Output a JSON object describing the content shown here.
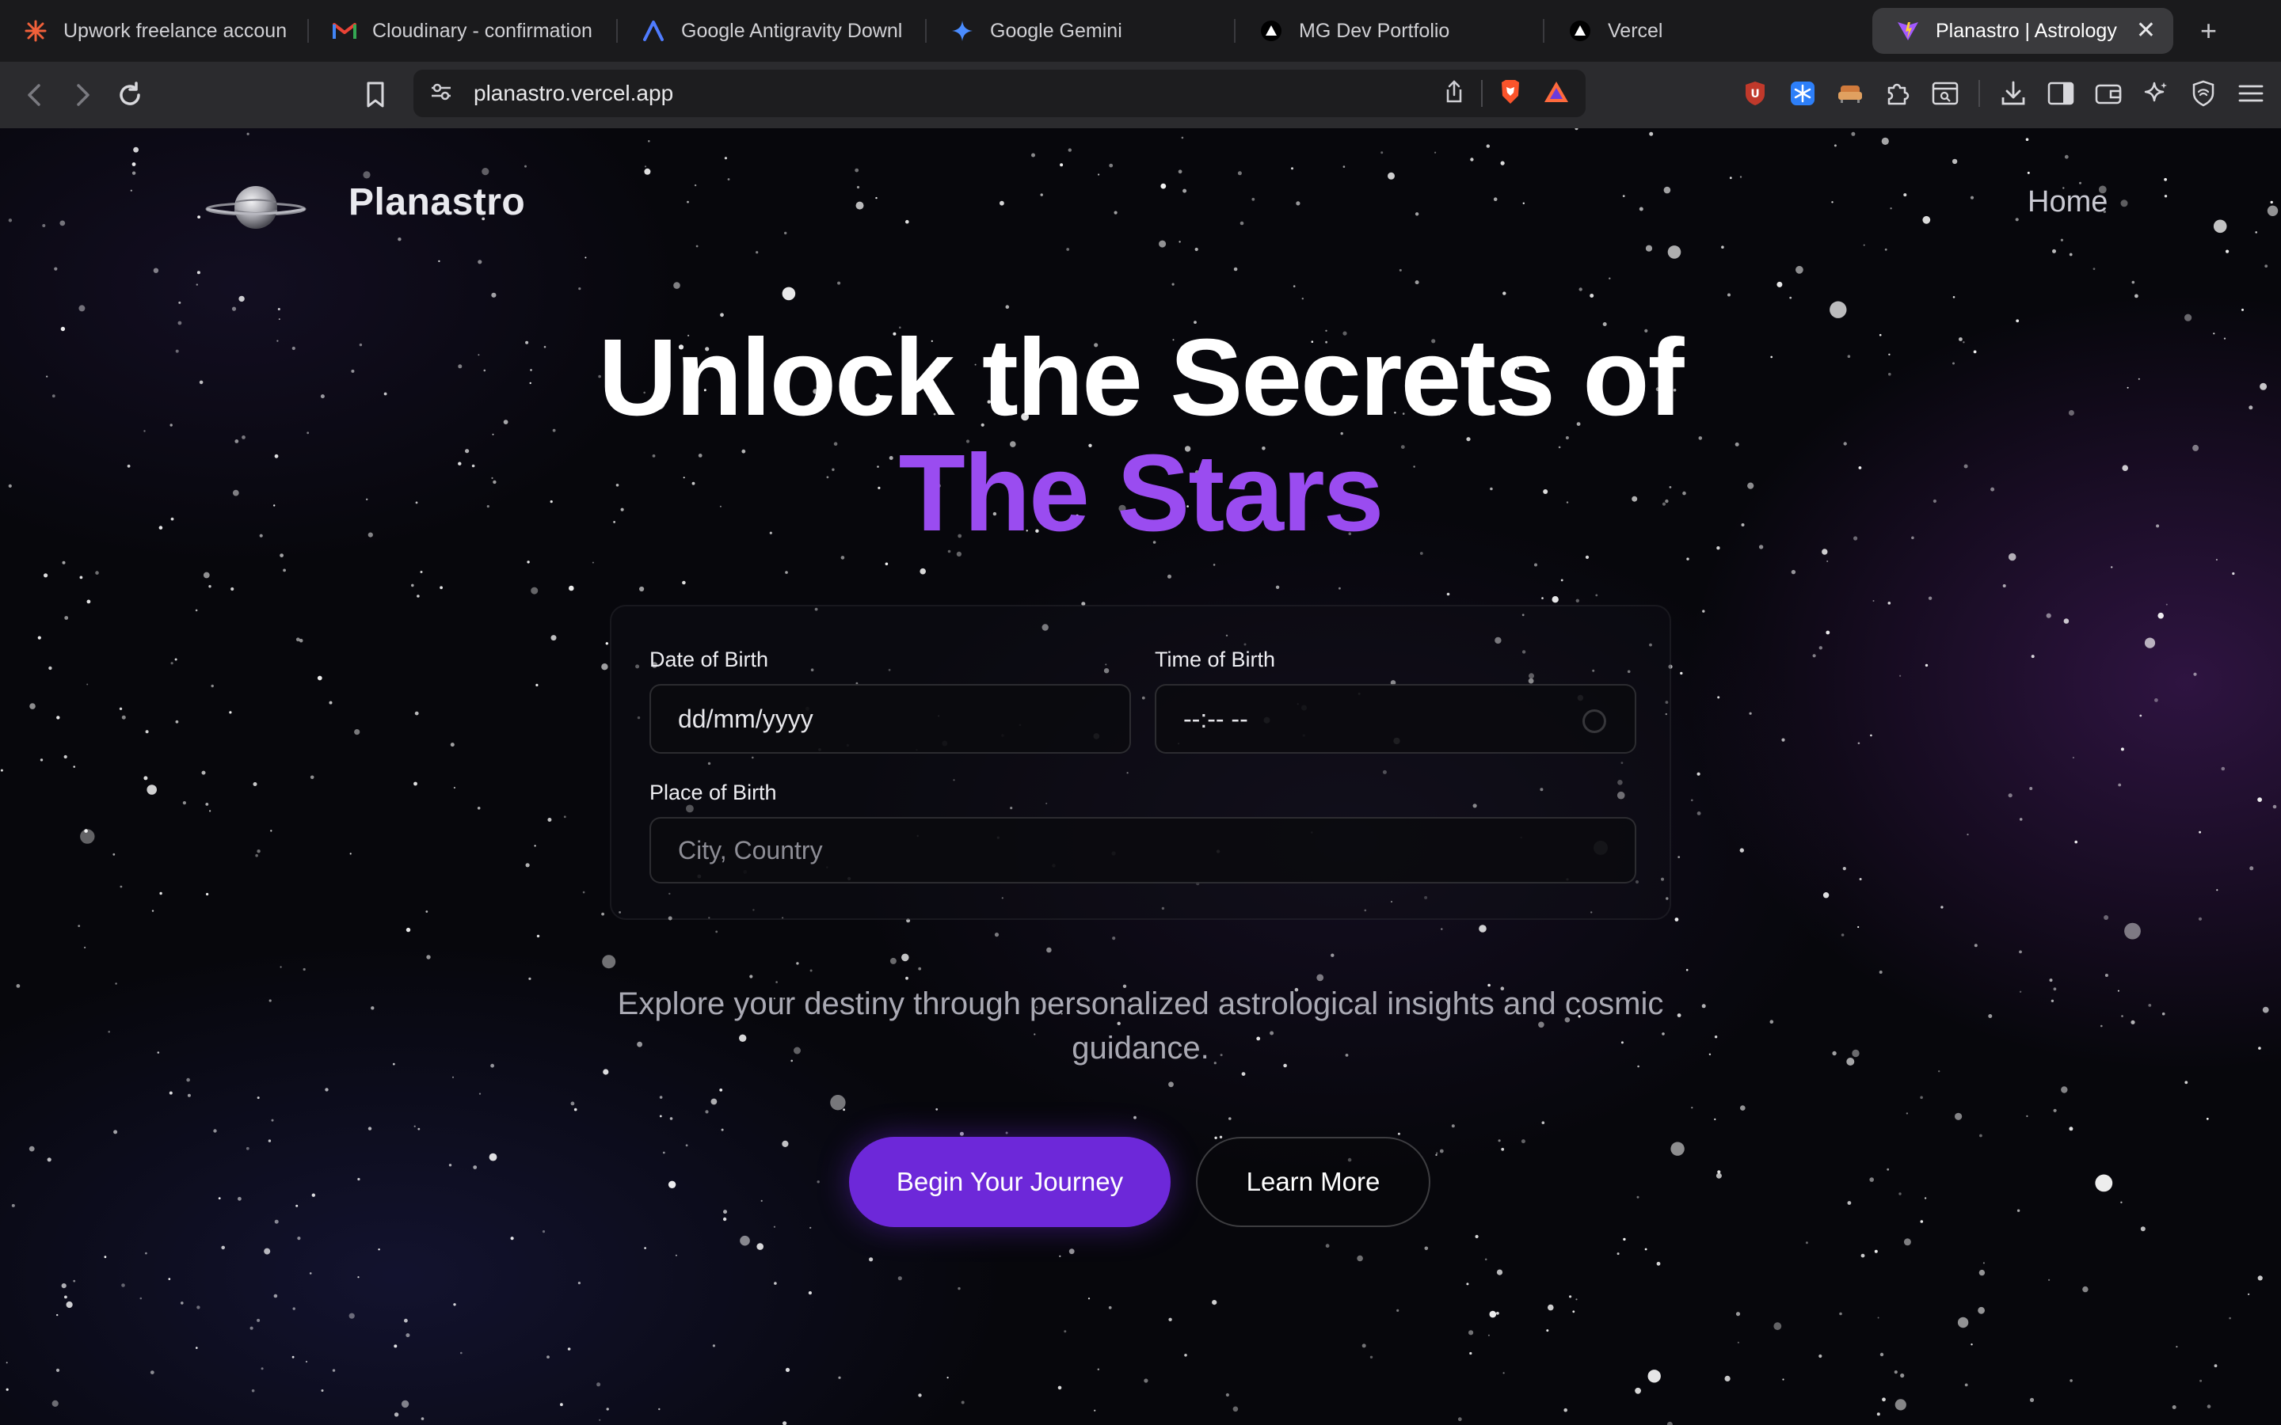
{
  "browser": {
    "tabs": [
      {
        "label": "Upwork freelance accoun",
        "icon": "upwork-asterisk-icon",
        "color": "#f0603a",
        "active": false
      },
      {
        "label": "Cloudinary - confirmation",
        "icon": "gmail-icon",
        "color": "#ea4335",
        "active": false
      },
      {
        "label": "Google Antigravity Downl",
        "icon": "antigravity-icon",
        "color": "#4f7cff",
        "active": false
      },
      {
        "label": "Google Gemini",
        "icon": "gemini-icon",
        "color": "#4a8cff",
        "active": false
      },
      {
        "label": "MG Dev Portfolio",
        "icon": "vercel-triangle-icon",
        "color": "#ffffff",
        "active": false
      },
      {
        "label": "Vercel",
        "icon": "vercel-triangle-icon",
        "color": "#ffffff",
        "active": false
      },
      {
        "label": "Planastro | Astrology",
        "icon": "vite-icon",
        "color": "#a259ff",
        "active": true
      }
    ],
    "close_glyph": "✕",
    "new_tab_glyph": "+",
    "url": "planastro.vercel.app"
  },
  "site": {
    "brand": "Planastro",
    "nav_home": "Home",
    "hero": {
      "line1": "Unlock the Secrets of",
      "line2": "The Stars",
      "accent_color": "#9a4cf0"
    },
    "form": {
      "dob_label": "Date of Birth",
      "dob_value": "dd/mm/yyyy",
      "tob_label": "Time of Birth",
      "tob_value": "--:-- --",
      "pob_label": "Place of Birth",
      "pob_placeholder": "City, Country"
    },
    "tagline": "Explore your destiny through personalized astrological insights and cosmic guidance.",
    "primary_button": "Begin Your Journey",
    "secondary_button": "Learn More",
    "primary_color": "#6d28d9"
  }
}
